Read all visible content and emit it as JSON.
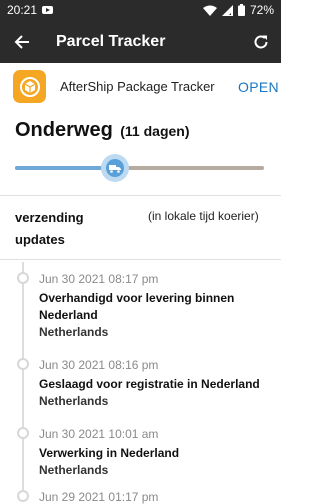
{
  "status_bar": {
    "time": "20:21",
    "battery": "72%"
  },
  "app_bar": {
    "title": "Parcel Tracker"
  },
  "ad": {
    "name": "AfterShip Package Tracker",
    "open_label": "OPEN"
  },
  "shipment": {
    "status": "Onderweg",
    "days": "(11 dagen)",
    "progress": 0.4
  },
  "updates": {
    "label": "verzending updates",
    "note": "(in lokale tijd koerier)"
  },
  "events": [
    {
      "date": "Jun 30 2021 08:17 pm",
      "description": "Overhandigd voor levering binnen Nederland",
      "location": "Netherlands"
    },
    {
      "date": "Jun 30 2021 08:16 pm",
      "description": "Geslaagd voor registratie in Nederland",
      "location": "Netherlands"
    },
    {
      "date": "Jun 30 2021 10:01 am",
      "description": "Verwerking in Nederland",
      "location": "Netherlands"
    },
    {
      "date": "Jun 29 2021 01:17 pm",
      "description": "",
      "location": ""
    }
  ],
  "colors": {
    "appbar": "#2b2b2b",
    "accent": "#1976c2",
    "progress": "#6fa9d8",
    "track": "#b5ab9f"
  }
}
